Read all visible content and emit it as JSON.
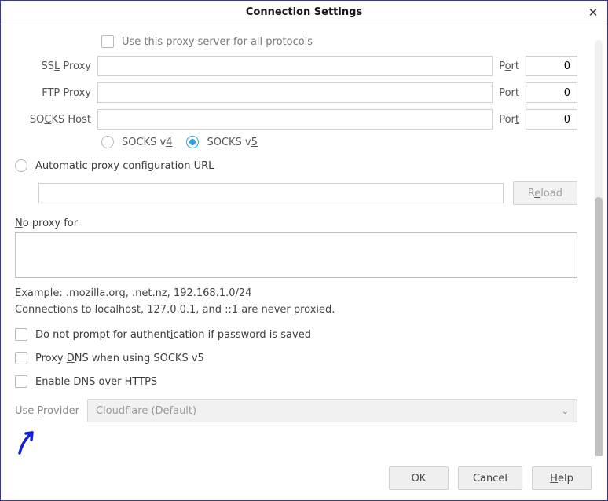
{
  "title": "Connection Settings",
  "useAllProtocols": "Use this proxy server for all protocols",
  "ssl": {
    "label": "SSL Proxy",
    "ul": "L",
    "portLabel": "Port",
    "portUl": "o",
    "port": "0"
  },
  "ftp": {
    "label": "FTP Proxy",
    "ul": "F",
    "portLabel": "Port",
    "portUl": "r",
    "port": "0"
  },
  "socks": {
    "label": "SOCKS Host",
    "ul": "C",
    "portLabel": "Port",
    "portUl": "t",
    "port": "0"
  },
  "socksVer": {
    "v4": "SOCKS v4",
    "v4ul": "4",
    "v5": "SOCKS v5",
    "v5ul": "5"
  },
  "pac": {
    "label": "Automatic proxy configuration URL",
    "ul": "A",
    "reload": "Reload",
    "reloadUl": "e"
  },
  "noProxy": {
    "label": "No proxy for",
    "ul": "N"
  },
  "example": "Example: .mozilla.org, .net.nz, 192.168.1.0/24",
  "note": "Connections to localhost, 127.0.0.1, and ::1 are never proxied.",
  "noPrompt": "Do not prompt for authentication if password is saved",
  "noPromptUl": "i",
  "proxyDns": "Proxy DNS when using SOCKS v5",
  "proxyDnsUl": "D",
  "doh": "Enable DNS over HTTPS",
  "provider": {
    "label": "Use Provider",
    "ul": "P",
    "value": "Cloudflare (Default)"
  },
  "buttons": {
    "ok": "OK",
    "cancel": "Cancel",
    "help": "Help",
    "helpUl": "H"
  }
}
